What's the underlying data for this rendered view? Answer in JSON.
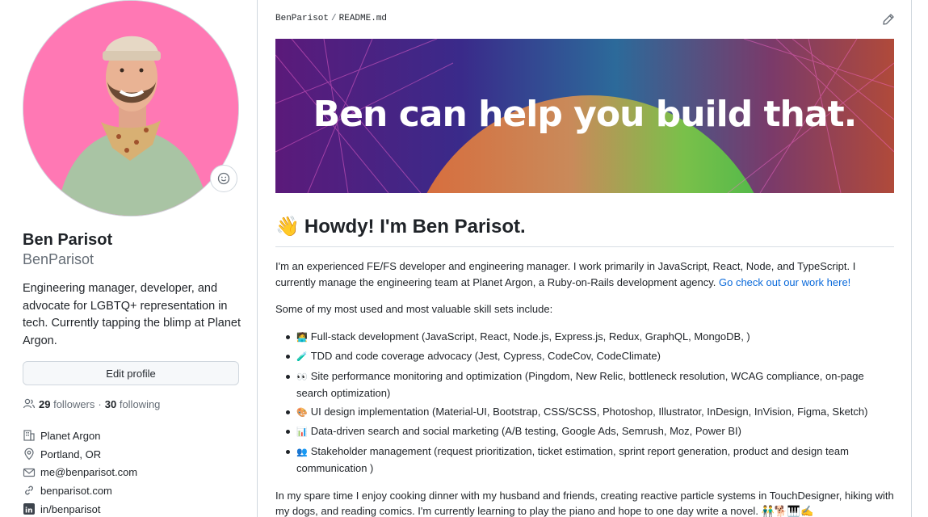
{
  "profile": {
    "name": "Ben Parisot",
    "login": "BenParisot",
    "bio": "Engineering manager, developer, and advocate for LGBTQ+ representation in tech. Currently tapping the blimp at Planet Argon.",
    "edit_label": "Edit profile",
    "followers_count": "29",
    "followers_label": "followers",
    "separator": "·",
    "following_count": "30",
    "following_label": "following",
    "details": [
      {
        "icon": "organization-icon",
        "text": "Planet Argon"
      },
      {
        "icon": "location-icon",
        "text": "Portland, OR"
      },
      {
        "icon": "mail-icon",
        "text": "me@benparisot.com"
      },
      {
        "icon": "link-icon",
        "text": "benparisot.com"
      },
      {
        "icon": "linkedin-icon",
        "text": "in/benparisot"
      }
    ],
    "avatar_bg": "#ff78b4"
  },
  "readme": {
    "breadcrumb_user": "BenParisot",
    "breadcrumb_sep": "/",
    "breadcrumb_file": "README.md",
    "banner_text": "Ben can help you build that.",
    "heading_emoji": "👋",
    "heading": "Howdy! I'm Ben Parisot.",
    "intro": "I'm an experienced FE/FS developer and engineering manager. I work primarily in JavaScript, React, Node, and TypeScript. I currently manage the engineering team at Planet Argon, a Ruby-on-Rails development agency.",
    "intro_link": "Go check out our work here!",
    "skills_intro": "Some of my most used and most valuable skill sets include:",
    "skills": [
      {
        "emoji": "🧑‍💻",
        "text": "Full-stack development (JavaScript, React, Node.js, Express.js, Redux, GraphQL, MongoDB, )"
      },
      {
        "emoji": "🧪",
        "text": "TDD and code coverage advocacy (Jest, Cypress, CodeCov, CodeClimate)"
      },
      {
        "emoji": "👀",
        "text": "Site performance monitoring and optimization (Pingdom, New Relic, bottleneck resolution, WCAG compliance, on-page search optimization)"
      },
      {
        "emoji": "🎨",
        "text": "UI design implementation (Material-UI, Bootstrap, CSS/SCSS, Photoshop, Illustrator, InDesign, InVision, Figma, Sketch)"
      },
      {
        "emoji": "📊",
        "text": "Data-driven search and social marketing (A/B testing, Google Ads, Semrush, Moz, Power BI)"
      },
      {
        "emoji": "👥",
        "text": "Stakeholder management (request prioritization, ticket estimation, sprint report generation, product and design team communication )"
      }
    ],
    "spare_time": "In my spare time I enjoy cooking dinner with my husband and friends, creating reactive particle systems in TouchDesigner, hiking with my dogs, and reading comics. I'm currently learning to play the piano and hope to one day write a novel. 👬🐕🎹✍️"
  }
}
